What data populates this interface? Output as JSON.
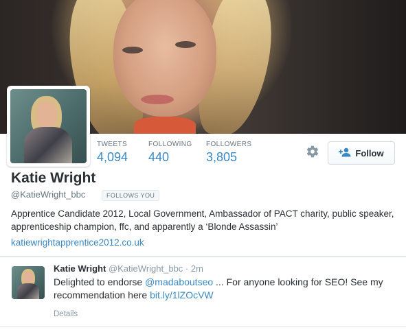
{
  "profile": {
    "name": "Katie Wright",
    "handle": "@KatieWright_bbc",
    "follows_you": "FOLLOWS YOU",
    "bio": "Apprentice Candidate 2012, Local Government, Ambassador of PACT charity, public speaker, apprenticeship champion, ffc, and apparently a ‘Blonde Assassin’",
    "website": "katiewrightapprentice2012.co.uk"
  },
  "stats": {
    "tweets_label": "TWEETS",
    "tweets_value": "4,094",
    "following_label": "FOLLOWING",
    "following_value": "440",
    "followers_label": "FOLLOWERS",
    "followers_value": "3,805"
  },
  "actions": {
    "follow_label": "Follow",
    "settings_icon": "gear-icon",
    "follow_icon": "add-user-icon"
  },
  "tweet": {
    "author_name": "Katie Wright",
    "author_handle": "@KatieWright_bbc",
    "separator": "·",
    "time": "2m",
    "text_before_mention": "Delighted to endorse ",
    "mention": "@madaboutseo",
    "text_after_mention": " ... For anyone looking for SEO! See my recommendation here ",
    "link": "bit.ly/1lZOcVW",
    "details_label": "Details"
  },
  "colors": {
    "link": "#3b88c3",
    "muted": "#66757f",
    "text": "#292f33"
  }
}
